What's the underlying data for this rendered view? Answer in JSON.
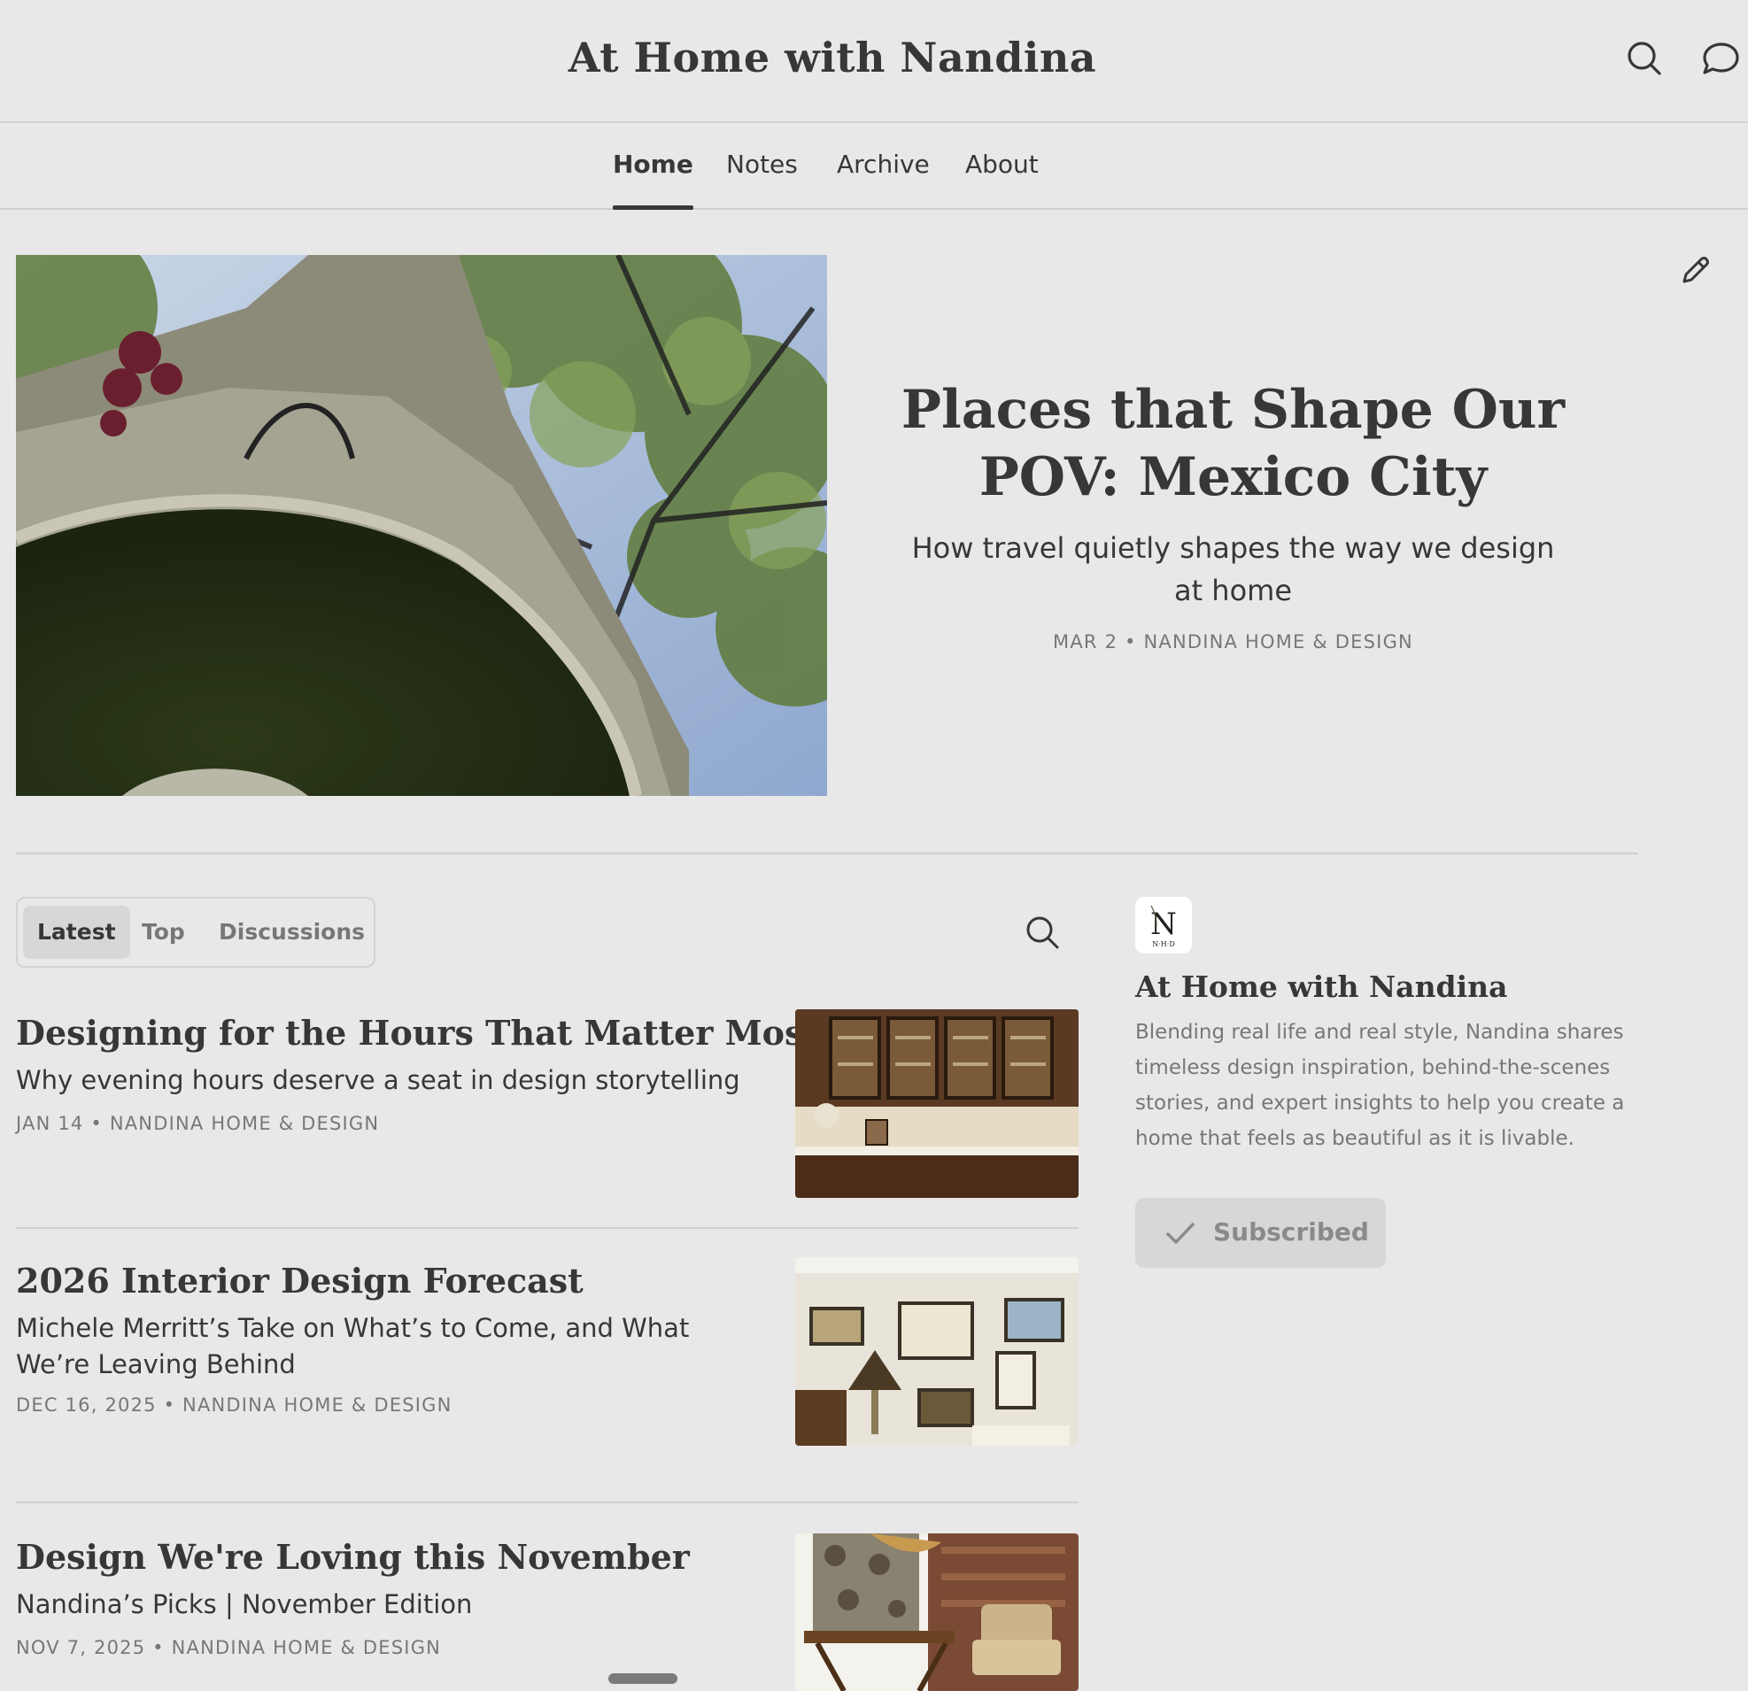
{
  "header": {
    "site_title": "At Home with Nandina",
    "search_icon": "search-icon",
    "chat_icon": "chat-bubble-icon"
  },
  "nav": {
    "tabs": [
      {
        "label": "Home",
        "active": true
      },
      {
        "label": "Notes",
        "active": false
      },
      {
        "label": "Archive",
        "active": false
      },
      {
        "label": "About",
        "active": false
      }
    ]
  },
  "hero": {
    "title": "Places that Shape Our POV: Mexico City",
    "subtitle": "How travel quietly shapes the way we design at home",
    "meta": "MAR 2 • NANDINA HOME & DESIGN",
    "edit_icon": "pencil-icon"
  },
  "filters": {
    "tabs": [
      {
        "label": "Latest",
        "active": true
      },
      {
        "label": "Top",
        "active": false
      },
      {
        "label": "Discussions",
        "active": false
      }
    ]
  },
  "posts": [
    {
      "title": "Designing for the Hours That Matter Most",
      "subtitle": "Why evening hours deserve a seat in design storytelling",
      "meta": "JAN 14 • NANDINA HOME & DESIGN"
    },
    {
      "title": "2026 Interior Design Forecast",
      "subtitle": "Michele Merritt’s Take on What’s to Come, and What We’re Leaving Behind",
      "meta": "DEC 16, 2025 • NANDINA HOME & DESIGN"
    },
    {
      "title": "Design We're Loving this November",
      "subtitle": "Nandina’s Picks | November Edition",
      "meta": "NOV 7, 2025 • NANDINA HOME & DESIGN"
    }
  ],
  "sidebar": {
    "logo_letter": "N",
    "logo_caption": "N·H·D",
    "title": "At Home with Nandina",
    "description": "Blending real life and real style, Nandina shares timeless design inspiration, behind-the-scenes stories, and expert insights to help you create a home that feels as beautiful as it is livable.",
    "subscribe_label": "Subscribed"
  },
  "colors": {
    "background": "#e8e8e8",
    "text": "#363737",
    "muted": "#777777",
    "divider": "#cfcfcf"
  }
}
